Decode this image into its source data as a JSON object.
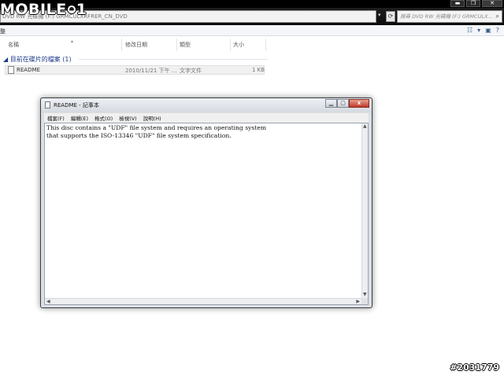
{
  "logo": "MOBILE01",
  "window": {
    "min": "▬",
    "max": "❐",
    "close": "✕"
  },
  "address": {
    "path": "DVD RW 光碟機 (F:) GRMCULXRFRER_CN_DVD"
  },
  "search": {
    "placeholder": "搜尋 DVD RW 光碟機 (F:) GRMCULX..."
  },
  "toolbar": {
    "left": "整"
  },
  "columns": [
    "名稱",
    "修改日期",
    "類型",
    "大小"
  ],
  "group": {
    "label": "目前在碟片的檔案 (1)"
  },
  "files": [
    {
      "name": "README",
      "date": "2010/11/21 下午 ...",
      "type": "文字文件",
      "size": "1 KB"
    }
  ],
  "notepad": {
    "title": "README - 記事本",
    "menu": [
      "檔案(F)",
      "編輯(E)",
      "格式(O)",
      "檢視(V)",
      "說明(H)"
    ],
    "content": "This disc contains a \"UDF\" file system and requires an operating system\nthat supports the ISO-13346 \"UDF\" file system specification."
  },
  "watermark": "#2031779"
}
